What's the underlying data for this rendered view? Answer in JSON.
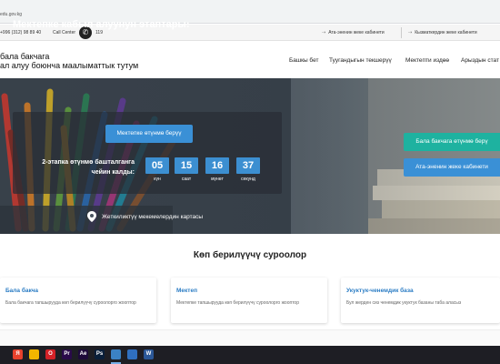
{
  "browser": {
    "url": "edu.gov.kg"
  },
  "topbar": {
    "phone": "+996 (312) 98 89 40",
    "call_center_label": "Call Center",
    "call_center_number": "119",
    "parent_cabinet": "Ата-эненин жеке кабинети",
    "kindergarten_cabinet": "Кызматкердин жеке кабинети"
  },
  "header": {
    "logo_line1": "бала бакчага",
    "logo_line2": "ал алуу боюнча маалыматтык тутум",
    "nav": [
      "Башкы бет",
      "Туугандыгын текшерүү",
      "Мектепти издөө",
      "Арыздын стат"
    ]
  },
  "hero": {
    "title": "Мектепке кабыл алуунун этаптары:",
    "apply_button": "Мектепке өтүнмө берүү",
    "countdown_label": "2-этапка өтүнмө башталганга чейин калды:",
    "countdown": [
      {
        "value": "05",
        "unit": "күн"
      },
      {
        "value": "15",
        "unit": "саат"
      },
      {
        "value": "16",
        "unit": "мүнөт"
      },
      {
        "value": "37",
        "unit": "секунд"
      }
    ],
    "map_link": "Жеткиликтүү мекемелердин картасы",
    "kindergarten_button": "Бала бакчага өтүнмө берү",
    "parent_cabinet_button": "Ата-эненин жеке кабинети"
  },
  "services": {
    "title": "Көп берилүүчү суроолор",
    "cards": [
      {
        "title": "Бала бакча",
        "desc": "Бала бакчага тапшырууда көп берилүүчү суроолорго жооптор"
      },
      {
        "title": "Мектеп",
        "desc": "Мектепке тапшырууда көп берилүүчү суроолорго жооптор"
      },
      {
        "title": "Укуктук-ченемдик база",
        "desc": "Бул жерден сиз ченемдик укуктук базаны таба аласыз"
      }
    ]
  },
  "taskbar": {
    "apps": [
      {
        "name": "yandex-icon",
        "label": "Я",
        "color": "#e8412c"
      },
      {
        "name": "chrome-icon",
        "label": "",
        "color": "#f2b600"
      },
      {
        "name": "opera-icon",
        "label": "O",
        "color": "#d42127"
      },
      {
        "name": "premiere-icon",
        "label": "Pr",
        "color": "#2a0a4a"
      },
      {
        "name": "aftereffects-icon",
        "label": "Ae",
        "color": "#1d0a3a"
      },
      {
        "name": "photoshop-icon",
        "label": "Ps",
        "color": "#0a1f3a"
      },
      {
        "name": "chrome-active-icon",
        "label": "",
        "color": "#3b82c4"
      },
      {
        "name": "photos-icon",
        "label": "",
        "color": "#2f6fbf"
      },
      {
        "name": "word-icon",
        "label": "W",
        "color": "#2b5797"
      }
    ]
  }
}
